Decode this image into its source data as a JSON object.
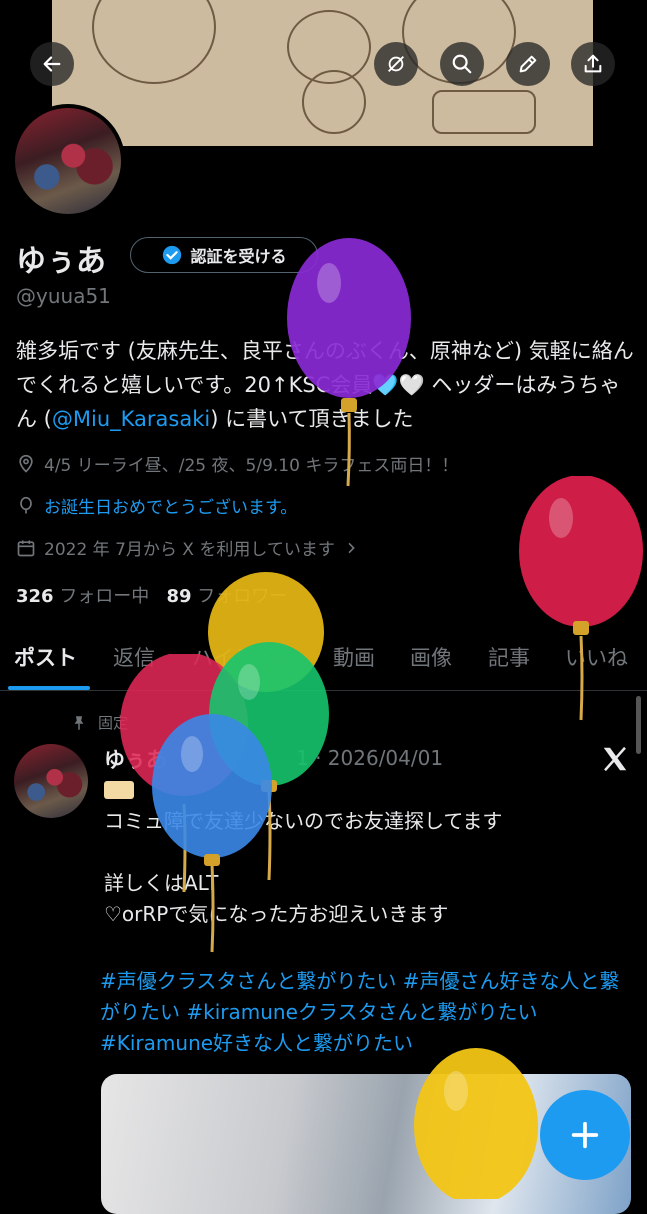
{
  "header": {
    "back_icon": "arrow-left-icon",
    "icons": [
      "hide-icon",
      "search-icon",
      "edit-icon",
      "share-icon"
    ]
  },
  "profile": {
    "display_name": "ゆぅあ",
    "verify_label": "認証を受ける",
    "handle": "@yuua51",
    "bio_part1": "雑多垢です (友麻先生、良平さんのぶくん、原神など) 気軽に絡んでくれると嬉しいです。20↑KSC会員🩵🤍 ヘッダーはみうちゃん (",
    "bio_link": "@Miu_Karasaki",
    "bio_part2": ") に書いて頂きました",
    "location": "4/5 リーライ昼、/25 夜、5/9.10 キラフェス両日！！",
    "birthday": "お誕生日おめでとうございます。",
    "joined": "2022 年 7月から X を利用しています",
    "following_count": "326",
    "following_label": "フォロー中",
    "followers_count": "89",
    "followers_label": "フォロワー"
  },
  "tabs": [
    "ポスト",
    "返信",
    "ハイライト",
    "動画",
    "画像",
    "記事",
    "いいね"
  ],
  "post": {
    "pinned_label": "固定",
    "author": "ゆぅあ",
    "date": "1 · 2026/04/01",
    "line1": "コミュ障で友達少ないのでお友達探してます",
    "line2": "詳しくはALT",
    "line3": "♡orRPで気になった方お迎えいきます",
    "hashtags": "#声優クラスタさんと繋がりたい  #声優さん好きな人と繋がりたい   #kiramuneクラスタさんと繋がりたい   #Kiramune好きな人と繋がりたい"
  },
  "colors": {
    "accent": "#1d9bf0",
    "background": "#000000",
    "muted": "#71767b"
  }
}
